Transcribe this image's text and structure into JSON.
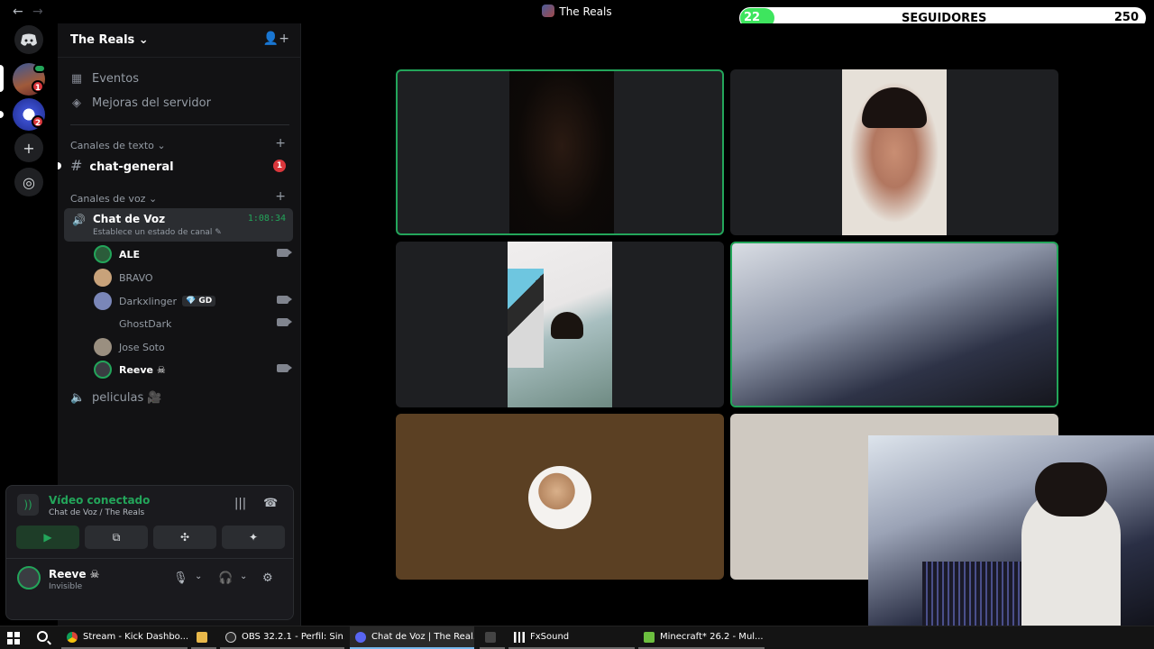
{
  "titlebar": {
    "back": "←",
    "forward": "→",
    "title": "The Reals",
    "icons": [
      "inbox-icon",
      "help-icon",
      "download-icon",
      "minimize-icon",
      "maximize-icon"
    ]
  },
  "overlay": {
    "count": "22",
    "label": "SEGUIDORES",
    "goal": "250",
    "progress": 0.088,
    "fill_color": "#3ee55e"
  },
  "servers": [
    {
      "name": "The Reals",
      "badge": "1"
    },
    {
      "name": "server-2",
      "badge": "2"
    }
  ],
  "server": {
    "name": "The Reals",
    "chevron": "⌄",
    "items": [
      {
        "label": "Eventos",
        "icon": "calendar-icon"
      },
      {
        "label": "Mejoras del servidor",
        "icon": "boost-icon"
      }
    ]
  },
  "text_category": {
    "label": "Canales de texto ⌄",
    "plus": "+"
  },
  "text_channel": {
    "hash": "#",
    "name": "chat-general",
    "badge": "1"
  },
  "voice_category": {
    "label": "Canales de voz ⌄",
    "plus": "+"
  },
  "voice_channel": {
    "name": "Chat de Voz",
    "time": "1:08:34",
    "status": "Establece un estado de canal ✎"
  },
  "members": [
    {
      "name": "ALE",
      "bold": true,
      "camera": true
    },
    {
      "name": "BRAVO",
      "bold": false,
      "camera": false
    },
    {
      "name": "Darkxlinger",
      "tag": "💎 GD",
      "bold": false,
      "camera": true
    },
    {
      "name": "GhostDark",
      "bold": false,
      "camera": true
    },
    {
      "name": "Jose Soto",
      "bold": false,
      "camera": false
    },
    {
      "name": "Reeve ☠",
      "bold": true,
      "camera": true
    }
  ],
  "other_channel": {
    "name": "peliculas 🎥"
  },
  "connection": {
    "title": "Vídeo conectado",
    "subtitle": "Chat de Voz / The Reals",
    "buttons": [
      "▶",
      "⧉",
      "✣",
      "✦"
    ]
  },
  "user": {
    "name": "Reeve ☠",
    "status": "Invisible",
    "mic": "🎙",
    "headset": "🎧",
    "settings": "⚙"
  },
  "tiles": [
    {
      "speaking": true,
      "bg": "#1e1f22"
    },
    {
      "speaking": false,
      "bg": "#1e1f22"
    },
    {
      "speaking": false,
      "bg": "#1e1f22"
    },
    {
      "speaking": true,
      "bg": "#1e1f22"
    },
    {
      "speaking": false,
      "bg": "#5b4023"
    },
    {
      "speaking": false,
      "bg": "#cfc9c1"
    }
  ],
  "taskbar": {
    "apps": [
      {
        "label": "Stream - Kick Dashbo...",
        "icon": "chrome-icon",
        "color": "#db4437"
      },
      {
        "label": "",
        "icon": "folder-icon",
        "color": "#e8b84a"
      },
      {
        "label": "OBS 32.2.1 - Perfil: Sin...",
        "icon": "obs-icon",
        "color": "#cccccc"
      },
      {
        "label": "Chat de Voz | The Real...",
        "icon": "discord-icon",
        "color": "#5865f2"
      },
      {
        "label": "",
        "icon": "terminal-icon",
        "color": "#444"
      },
      {
        "label": "FxSound",
        "icon": "fxsound-icon",
        "color": "#ffffff"
      },
      {
        "label": "Minecraft* 26.2 - Mul...",
        "icon": "minecraft-icon",
        "color": "#6cbf3f"
      }
    ]
  }
}
